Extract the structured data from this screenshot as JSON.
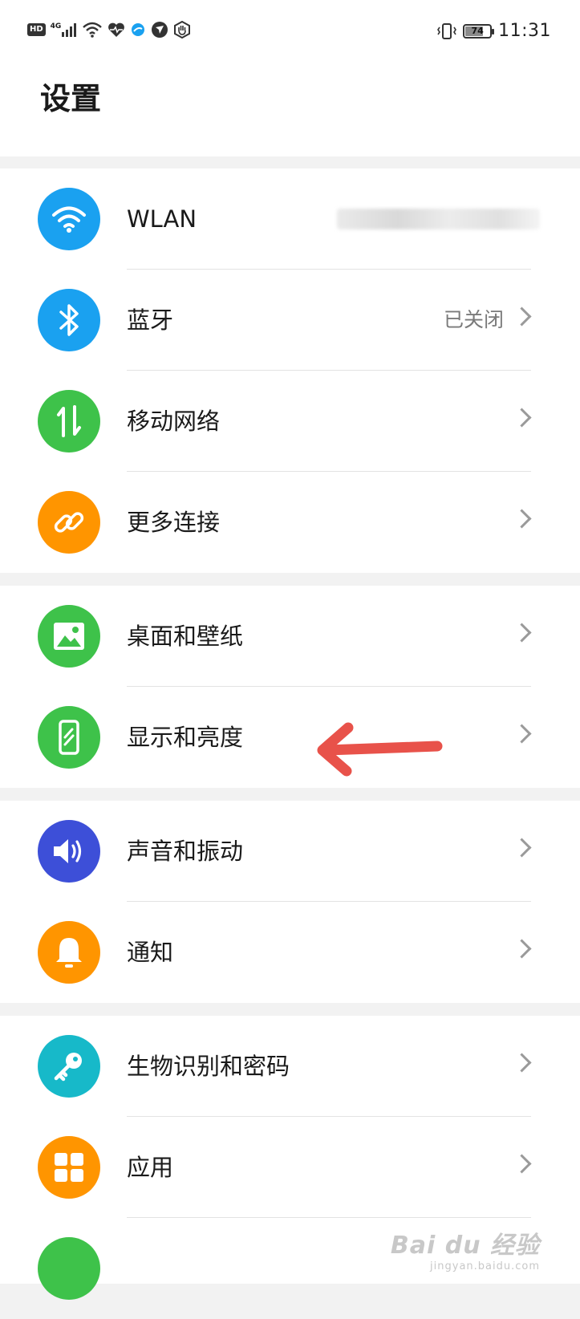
{
  "status_bar": {
    "hd_label": "HD",
    "network_label": "4G",
    "battery_percent": "74",
    "battery_level": 0.74,
    "time": "11:31",
    "icons": [
      "signal-icon",
      "wifi-icon",
      "heart-health-icon",
      "app-dot-icon",
      "navigation-icon",
      "hand-icon",
      "vibrate-icon"
    ]
  },
  "header": {
    "title": "设置"
  },
  "groups": [
    {
      "items": [
        {
          "label": "WLAN",
          "value": "",
          "icon": "wifi-icon",
          "color": "#1aa1f0"
        },
        {
          "label": "蓝牙",
          "value": "已关闭",
          "icon": "bluetooth-icon",
          "color": "#1aa1f0"
        },
        {
          "label": "移动网络",
          "value": "",
          "icon": "mobile-data-icon",
          "color": "#3ec24a"
        },
        {
          "label": "更多连接",
          "value": "",
          "icon": "link-icon",
          "color": "#ff9500"
        }
      ]
    },
    {
      "items": [
        {
          "label": "桌面和壁纸",
          "value": "",
          "icon": "image-icon",
          "color": "#3ec24a"
        },
        {
          "label": "显示和亮度",
          "value": "",
          "icon": "phone-display-icon",
          "color": "#3ec24a"
        }
      ]
    },
    {
      "items": [
        {
          "label": "声音和振动",
          "value": "",
          "icon": "speaker-icon",
          "color": "#3d4fd8"
        },
        {
          "label": "通知",
          "value": "",
          "icon": "bell-icon",
          "color": "#ff9500"
        }
      ]
    },
    {
      "items": [
        {
          "label": "生物识别和密码",
          "value": "",
          "icon": "key-icon",
          "color": "#17b9c9"
        },
        {
          "label": "应用",
          "value": "",
          "icon": "apps-grid-icon",
          "color": "#ff9500"
        }
      ]
    }
  ],
  "annotation": {
    "color": "#e8524a",
    "icon": "red-arrow-annotation"
  },
  "watermark": {
    "main": "Bai du 经验",
    "sub": "jingyan.baidu.com"
  }
}
